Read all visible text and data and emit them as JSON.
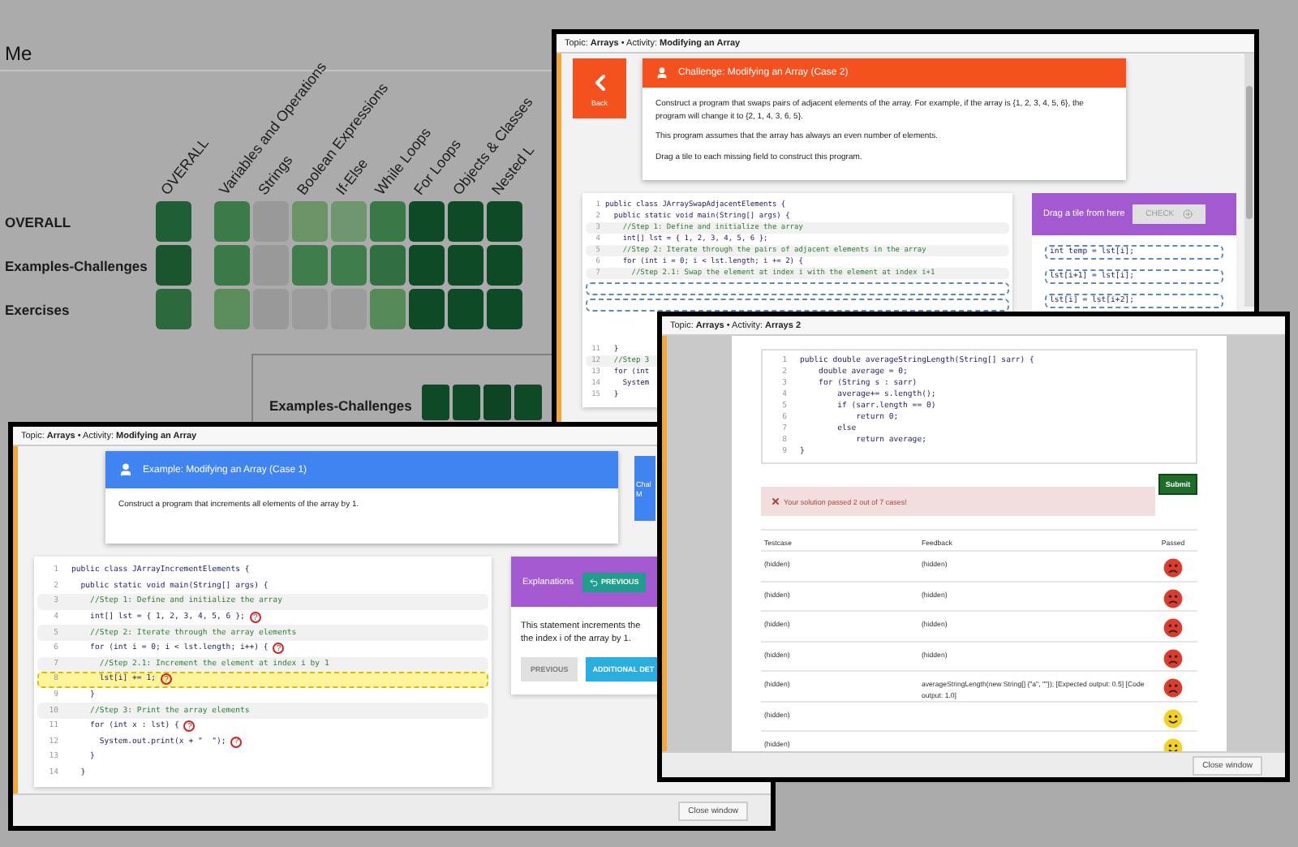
{
  "dashboard": {
    "title": "Me",
    "columns": [
      "OVERALL",
      "Variables and Operations",
      "Strings",
      "Boolean Expressions",
      "If-Else",
      "While Loops",
      "For Loops",
      "Objects & Classes",
      "Nested L"
    ],
    "rows": [
      {
        "label": "OVERALL",
        "cells": [
          {
            "color": "#1f5f36"
          },
          {
            "color": "#3b7b4a"
          },
          {
            "color": "#999999"
          },
          {
            "color": "#6a9467"
          },
          {
            "color": "#6e9770"
          },
          {
            "color": "#397947"
          },
          {
            "color": "#0e4a25"
          },
          {
            "color": "#0e4a25"
          },
          {
            "color": "#0e4a25"
          }
        ]
      },
      {
        "label": "Examples-Challenges",
        "cells": [
          {
            "color": "#1a5530"
          },
          {
            "color": "#3a7a48"
          },
          {
            "color": "#999999"
          },
          {
            "color": "#3f7d4c"
          },
          {
            "color": "#3f7d4c"
          },
          {
            "color": "#2f6f40"
          },
          {
            "color": "#0e4a25"
          },
          {
            "color": "#0e4a25"
          },
          {
            "color": "#0e4a25"
          }
        ]
      },
      {
        "label": "Exercises",
        "cells": [
          {
            "color": "#2a6a3c"
          },
          {
            "color": "#5a8c5c"
          },
          {
            "color": "#999999"
          },
          {
            "color": "#9b9b9b"
          },
          {
            "color": "#9b9b9b"
          },
          {
            "color": "#568a58"
          },
          {
            "color": "#0e4a25"
          },
          {
            "color": "#0e4a25"
          },
          {
            "color": "#0e4a25"
          }
        ]
      }
    ],
    "popover": {
      "label": "Examples-Challenges",
      "cells": [
        {
          "color": "#0e4a25"
        },
        {
          "color": "#0e4a25"
        },
        {
          "color": "#0d4424"
        },
        {
          "color": "#0e4a25"
        }
      ]
    }
  },
  "challenge_window": {
    "title": "Topic: **Arrays**  •  Activity: **Modifying an Array**",
    "back": "Back",
    "card_title": "Challenge: Modifying an Array (Case 2)",
    "paragraphs": [
      "Construct a program that swaps pairs of adjacent elements of the array. For example, if the array is {1, 2, 3, 4, 5, 6}, the program will change it to {2, 1, 4, 3, 6, 5}.",
      "This program assumes that the array has always an even number of elements.",
      "Drag a tile to each missing field to construct this program."
    ],
    "code": [
      {
        "kind": "code",
        "n": "1",
        "text": "public class JArraySwapAdjacentElements {"
      },
      {
        "kind": "code",
        "n": "2",
        "text": "  public static void main(String[] args) {"
      },
      {
        "kind": "comment",
        "n": "3",
        "text": "    //Step 1: Define and initialize the array"
      },
      {
        "kind": "code",
        "n": "4",
        "text": "    int[] lst = { 1, 2, 3, 4, 5, 6 };"
      },
      {
        "kind": "comment",
        "n": "5",
        "text": "    //Step 2: Iterate through the pairs of adjacent elements in the array"
      },
      {
        "kind": "code",
        "n": "6",
        "text": "    for (int i = 0; i < lst.length; i += 2) {"
      },
      {
        "kind": "comment",
        "n": "7",
        "text": "      //Step 2.1: Swap the element at index i with the element at index i+1"
      },
      {
        "kind": "blank"
      },
      {
        "kind": "blank"
      },
      {
        "kind": "code",
        "n": "11",
        "text": "  }"
      },
      {
        "kind": "comment",
        "n": "12",
        "text": "  //Step 3"
      },
      {
        "kind": "code",
        "n": "13",
        "text": "  for (int"
      },
      {
        "kind": "code",
        "n": "14",
        "text": "    System"
      },
      {
        "kind": "code",
        "n": "15",
        "text": "  }"
      }
    ],
    "tiles_panel": {
      "title": "Drag a tile from here",
      "check": "CHECK",
      "tiles": [
        "int temp = lst[i];",
        "lst[i+1] = lst[i];",
        "lst[i] = lst[i+2];"
      ]
    }
  },
  "example_window": {
    "title": "Topic: **Arrays**  •  Activity: **Modifying an Array**",
    "card_title": "Example: Modifying an Array (Case 1)",
    "card_text": "Construct a program that increments all elements of the array by 1.",
    "side_button": [
      "Chal",
      "M"
    ],
    "code": [
      {
        "kind": "code",
        "n": "1",
        "text": "public class JArrayIncrementElements {",
        "selected": false
      },
      {
        "kind": "code",
        "n": "2",
        "text": "  public static void main(String[] args) {",
        "selected": false
      },
      {
        "kind": "comment",
        "n": "3",
        "text": "    //Step 1: Define and initialize the array",
        "selected": false
      },
      {
        "kind": "code",
        "n": "4",
        "text": "    int[] lst = { 1, 2, 3, 4, 5, 6 };",
        "mark": "?",
        "selected": false
      },
      {
        "kind": "comment",
        "n": "5",
        "text": "    //Step 2: Iterate through the array elements",
        "selected": false
      },
      {
        "kind": "code",
        "n": "6",
        "text": "    for (int i = 0; i < lst.length; i++) {",
        "mark": "?",
        "selected": false
      },
      {
        "kind": "comment",
        "n": "7",
        "text": "      //Step 2.1: Increment the element at index i by 1",
        "selected": false
      },
      {
        "kind": "code",
        "n": "8",
        "text": "      lst[i] += 1;",
        "mark": "?",
        "selected": true
      },
      {
        "kind": "code",
        "n": "9",
        "text": "    }",
        "selected": false
      },
      {
        "kind": "comment",
        "n": "10",
        "text": "    //Step 3: Print the array elements",
        "selected": false
      },
      {
        "kind": "code",
        "n": "11",
        "text": "    for (int x : lst) {",
        "mark": "?",
        "selected": false
      },
      {
        "kind": "code",
        "n": "12",
        "text": "      System.out.print(x + \"  \");",
        "mark": "?",
        "selected": false
      },
      {
        "kind": "code",
        "n": "13",
        "text": "    }",
        "selected": false
      },
      {
        "kind": "code",
        "n": "14",
        "text": "  }",
        "selected": false
      }
    ],
    "explanations": {
      "title": "Explanations",
      "previous_top": "PREVIOUS",
      "text_lines": [
        "This statement increments the",
        "the index i of the array by 1."
      ],
      "previous": "PREVIOUS",
      "details": "ADDITIONAL DET"
    },
    "close": "Close window"
  },
  "exercise_window": {
    "title": "Topic: **Arrays**  •  Activity: **Arrays 2**",
    "code": [
      {
        "n": "1",
        "text": "public double averageStringLength(String[] sarr) {"
      },
      {
        "n": "2",
        "text": "    double average = 0;"
      },
      {
        "n": "3",
        "text": "    for (String s : sarr)"
      },
      {
        "n": "4",
        "text": "        average+= s.length();"
      },
      {
        "n": "5",
        "text": "        if (sarr.length == 0)"
      },
      {
        "n": "6",
        "text": "            return 0;"
      },
      {
        "n": "7",
        "text": "        else"
      },
      {
        "n": "8",
        "text": "            return average;"
      },
      {
        "n": "9",
        "text": "}"
      }
    ],
    "submit": "Submit",
    "alert": "Your solution passed 2 out of 7 cases!",
    "table": {
      "columns": [
        "Testcase",
        "Feedback",
        "Passed"
      ],
      "rows": [
        {
          "testcase": "(hidden)",
          "feedback": "(hidden)",
          "passed": false
        },
        {
          "testcase": "(hidden)",
          "feedback": "(hidden)",
          "passed": false
        },
        {
          "testcase": "(hidden)",
          "feedback": "(hidden)",
          "passed": false
        },
        {
          "testcase": "(hidden)",
          "feedback": "(hidden)",
          "passed": false
        },
        {
          "testcase": "(hidden)",
          "feedback": "averageStringLength(new String[] {\"a\", \"\"}); [Expected output: 0.5] [Code output: 1.0]",
          "passed": false
        },
        {
          "testcase": "(hidden)",
          "passed": true
        },
        {
          "testcase": "(hidden)",
          "passed": true
        }
      ]
    },
    "close": "Close window"
  }
}
